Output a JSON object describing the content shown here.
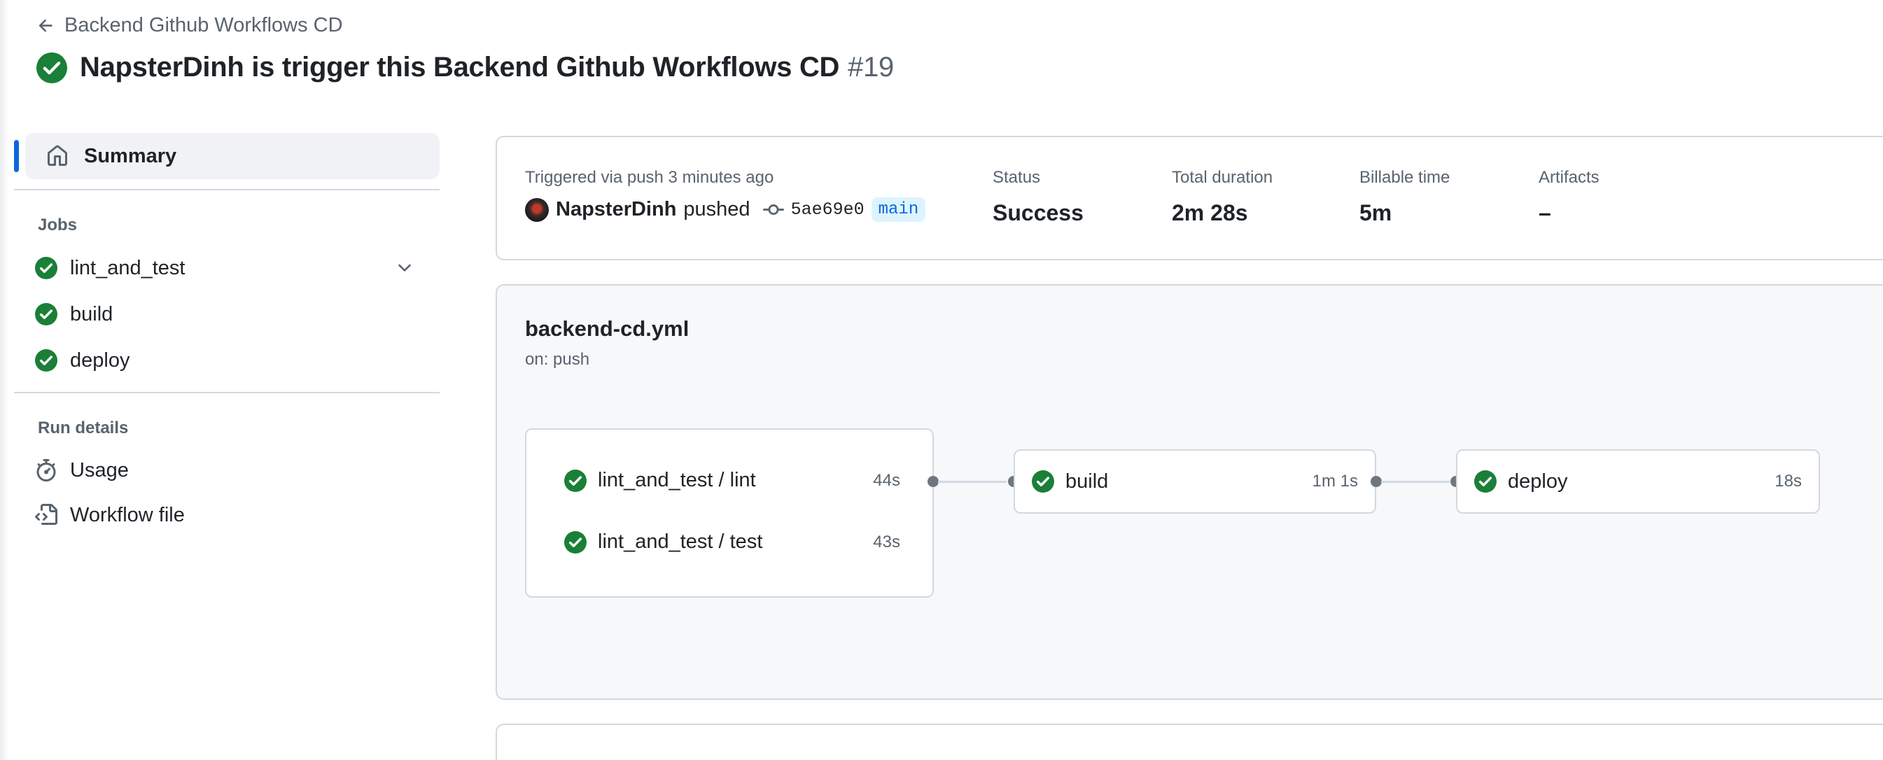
{
  "header": {
    "back_label": "Backend Github Workflows CD",
    "title": "NapsterDinh is trigger this Backend Github Workflows CD",
    "run_number": "#19"
  },
  "sidebar": {
    "summary_label": "Summary",
    "jobs_heading": "Jobs",
    "jobs": [
      {
        "label": "lint_and_test",
        "status": "success",
        "expandable": true
      },
      {
        "label": "build",
        "status": "success"
      },
      {
        "label": "deploy",
        "status": "success"
      }
    ],
    "run_details_heading": "Run details",
    "details": [
      {
        "label": "Usage",
        "icon": "stopwatch-icon"
      },
      {
        "label": "Workflow file",
        "icon": "file-code-icon"
      }
    ]
  },
  "summary": {
    "trigger_text": "Triggered via push 3 minutes ago",
    "actor": "NapsterDinh",
    "action": "pushed",
    "commit_sha": "5ae69e0",
    "branch": "main",
    "status_label": "Status",
    "status_value": "Success",
    "duration_label": "Total duration",
    "duration_value": "2m 28s",
    "billable_label": "Billable time",
    "billable_value": "5m",
    "artifacts_label": "Artifacts",
    "artifacts_value": "–"
  },
  "workflow": {
    "file": "backend-cd.yml",
    "on": "on: push",
    "group_jobs": [
      {
        "name": "lint_and_test / lint",
        "duration": "44s"
      },
      {
        "name": "lint_and_test / test",
        "duration": "43s"
      }
    ],
    "build": {
      "name": "build",
      "duration": "1m 1s"
    },
    "deploy": {
      "name": "deploy",
      "duration": "18s"
    }
  },
  "colors": {
    "success": "#1a7f37",
    "accent": "#0969da",
    "border": "#d1d9e0",
    "muted": "#59636e"
  }
}
